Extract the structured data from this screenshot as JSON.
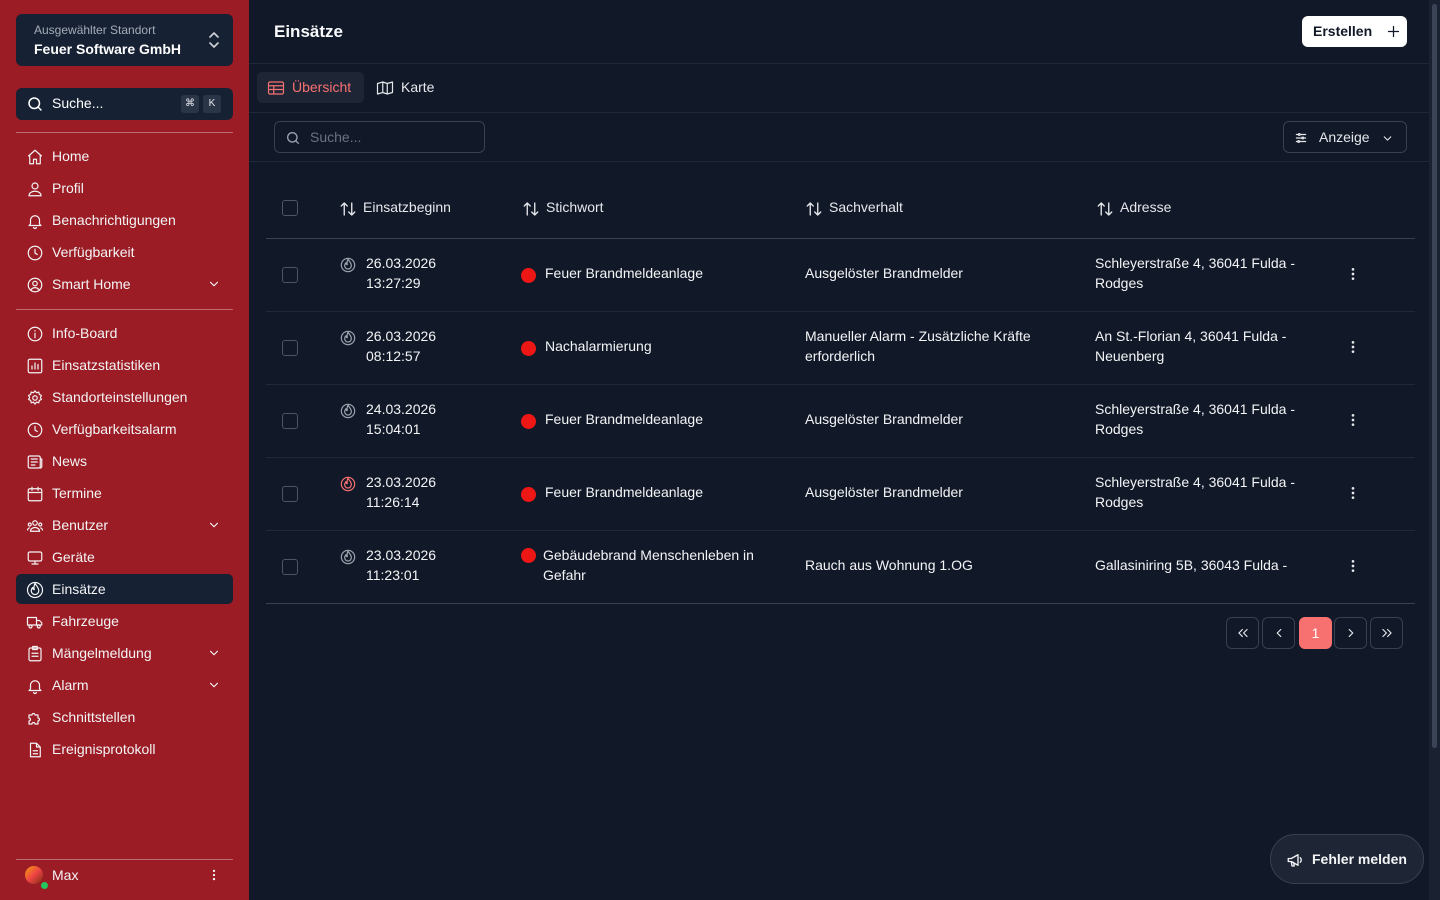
{
  "sidebar": {
    "location_label": "Ausgewählter Standort",
    "location_name": "Feuer Software GmbH",
    "search_label": "Suche...",
    "kbd": [
      "⌘",
      "K"
    ],
    "items": [
      {
        "label": "Home",
        "icon": "home-icon"
      },
      {
        "label": "Profil",
        "icon": "user-icon"
      },
      {
        "label": "Benachrichtigungen",
        "icon": "bell-icon"
      },
      {
        "label": "Verfügbarkeit",
        "icon": "clock-icon"
      },
      {
        "label": "Smart Home",
        "icon": "user-circle-icon"
      },
      {
        "label": "Info-Board",
        "icon": "info-icon"
      },
      {
        "label": "Einsatzstatistiken",
        "icon": "chart-icon"
      },
      {
        "label": "Standorteinstellungen",
        "icon": "gear-icon"
      },
      {
        "label": "Verfügbarkeitsalarm",
        "icon": "clock-icon"
      },
      {
        "label": "News",
        "icon": "newspaper-icon"
      },
      {
        "label": "Termine",
        "icon": "calendar-icon"
      },
      {
        "label": "Benutzer",
        "icon": "users-icon"
      },
      {
        "label": "Geräte",
        "icon": "monitor-icon"
      },
      {
        "label": "Einsätze",
        "icon": "flame-icon"
      },
      {
        "label": "Fahrzeuge",
        "icon": "truck-icon"
      },
      {
        "label": "Mängelmeldung",
        "icon": "clipboard-icon"
      },
      {
        "label": "Alarm",
        "icon": "bell-icon"
      },
      {
        "label": "Schnittstellen",
        "icon": "puzzle-icon"
      },
      {
        "label": "Ereignisprotokoll",
        "icon": "document-icon"
      }
    ],
    "user_name": "Max"
  },
  "header": {
    "title": "Einsätze",
    "create_label": "Erstellen"
  },
  "tabs": [
    {
      "label": "Übersicht",
      "active": true
    },
    {
      "label": "Karte",
      "active": false
    }
  ],
  "toolbar": {
    "search_placeholder": "Suche...",
    "view_label": "Anzeige"
  },
  "table": {
    "columns": [
      "Einsatzbeginn",
      "Stichwort",
      "Sachverhalt",
      "Adresse"
    ],
    "rows": [
      {
        "date": "26.03.2026",
        "time": "13:27:29",
        "keyword": "Feuer Brandmeldeanlage",
        "subject": "Ausgelöster Brandmelder",
        "address": "Schleyerstraße 4, 36041 Fulda - Rodges",
        "fire_active": false
      },
      {
        "date": "26.03.2026",
        "time": "08:12:57",
        "keyword": "Nachalarmierung",
        "subject": "Manueller Alarm - Zusätzliche Kräfte erforderlich",
        "address": "An St.-Florian 4, 36041 Fulda - Neuenberg",
        "fire_active": false
      },
      {
        "date": "24.03.2026",
        "time": "15:04:01",
        "keyword": "Feuer Brandmeldeanlage",
        "subject": "Ausgelöster Brandmelder",
        "address": "Schleyerstraße 4, 36041 Fulda - Rodges",
        "fire_active": false
      },
      {
        "date": "23.03.2026",
        "time": "11:26:14",
        "keyword": "Feuer Brandmeldeanlage",
        "subject": "Ausgelöster Brandmelder",
        "address": "Schleyerstraße 4, 36041 Fulda - Rodges",
        "fire_active": true
      },
      {
        "date": "23.03.2026",
        "time": "11:23:01",
        "keyword": "Gebäudebrand Menschenleben in Gefahr",
        "subject": "Rauch aus Wohnung 1.OG",
        "address": "Gallasiniring 5B, 36043 Fulda -",
        "fire_active": false
      }
    ]
  },
  "pagination": {
    "current_page": "1"
  },
  "feedback_label": "Fehler melden",
  "colors": {
    "sidebar": "#9b1c24",
    "background": "#111827",
    "accent": "#f87171",
    "status_red": "#ef1616"
  }
}
